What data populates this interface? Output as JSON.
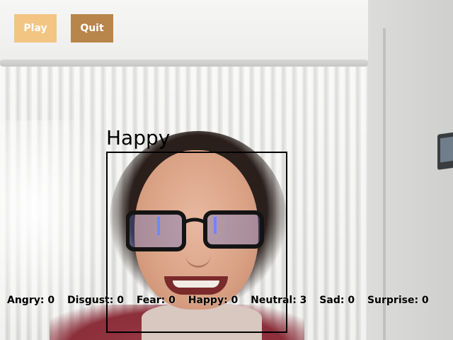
{
  "buttons": {
    "play_label": "Play",
    "quit_label": "Quit"
  },
  "detection": {
    "emotion_label": "Happy"
  },
  "counts": [
    {
      "text": "Angry: 0"
    },
    {
      "text": "Disgust: 0"
    },
    {
      "text": "Fear: 0"
    },
    {
      "text": "Happy: 0"
    },
    {
      "text": "Neutral: 3"
    },
    {
      "text": "Sad: 0"
    },
    {
      "text": "Surprise: 0"
    }
  ],
  "colors": {
    "play_button": "#f2c583",
    "quit_button": "#b8864a",
    "face_box": "#000000"
  }
}
